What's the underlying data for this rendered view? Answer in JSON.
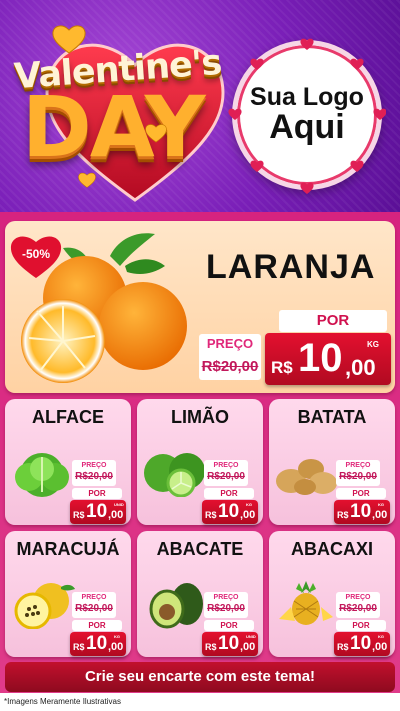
{
  "header": {
    "title_top": "Valentine's",
    "title_bottom": "DAY",
    "logo_line1": "Sua Logo",
    "logo_line2": "Aqui"
  },
  "hero": {
    "name": "LARANJA",
    "discount": "-50%",
    "preco_label": "PREÇO",
    "old_price": "R$20,00",
    "por_label": "POR",
    "currency": "R$",
    "price_int": "10",
    "price_dec": ",00",
    "unit": "KG",
    "icon": "orange-fruit-icon"
  },
  "products": [
    {
      "name": "ALFACE",
      "preco_label": "PREÇO",
      "old_price": "R$20,00",
      "por_label": "POR",
      "currency": "R$",
      "price_int": "10",
      "price_dec": ",00",
      "unit": "UNID",
      "icon": "lettuce-icon"
    },
    {
      "name": "LIMÃO",
      "preco_label": "PREÇO",
      "old_price": "R$20,00",
      "por_label": "POR",
      "currency": "R$",
      "price_int": "10",
      "price_dec": ",00",
      "unit": "KG",
      "icon": "lime-icon"
    },
    {
      "name": "BATATA",
      "preco_label": "PREÇO",
      "old_price": "R$20,00",
      "por_label": "POR",
      "currency": "R$",
      "price_int": "10",
      "price_dec": ",00",
      "unit": "KG",
      "icon": "potato-icon"
    },
    {
      "name": "MARACUJÁ",
      "preco_label": "PREÇO",
      "old_price": "R$20,00",
      "por_label": "POR",
      "currency": "R$",
      "price_int": "10",
      "price_dec": ",00",
      "unit": "KG",
      "icon": "passion-fruit-icon"
    },
    {
      "name": "ABACATE",
      "preco_label": "PREÇO",
      "old_price": "R$20,00",
      "por_label": "POR",
      "currency": "R$",
      "price_int": "10",
      "price_dec": ",00",
      "unit": "UNID",
      "icon": "avocado-icon"
    },
    {
      "name": "ABACAXI",
      "preco_label": "PREÇO",
      "old_price": "R$20,00",
      "por_label": "POR",
      "currency": "R$",
      "price_int": "10",
      "price_dec": ",00",
      "unit": "KG",
      "icon": "pineapple-icon"
    }
  ],
  "footer": {
    "banner": "Crie seu encarte com este tema!",
    "disclaimer": "*Imagens Meramente Ilustrativas"
  },
  "colors": {
    "purple": "#7a1fb8",
    "pink": "#d6237f",
    "red_price": "#c8102e",
    "gold": "#ffb02e"
  }
}
